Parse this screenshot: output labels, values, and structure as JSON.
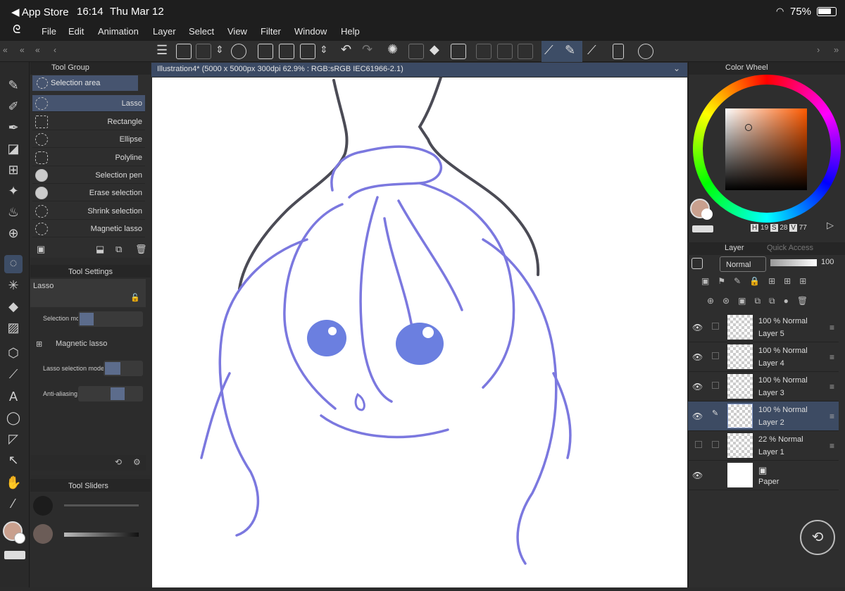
{
  "status": {
    "back": "◀ App Store",
    "time": "16:14",
    "date": "Thu Mar 12",
    "battery": "75%"
  },
  "menu": [
    "File",
    "Edit",
    "Animation",
    "Layer",
    "Select",
    "View",
    "Filter",
    "Window",
    "Help"
  ],
  "tool_group": {
    "title": "Tool Group",
    "active": "Selection area",
    "items": [
      "Lasso",
      "Rectangle",
      "Ellipse",
      "Polyline",
      "Selection pen",
      "Erase selection",
      "Shrink selection",
      "Magnetic lasso"
    ]
  },
  "tool_settings": {
    "title": "Tool Settings",
    "tool_name": "Lasso",
    "selection_mode_label": "Selection mo",
    "magnetic_label": "Magnetic lasso",
    "lasso_mode_label": "Lasso selection mode",
    "antialias_label": "Anti-aliasing"
  },
  "tool_sliders": {
    "title": "Tool Sliders"
  },
  "document": {
    "tab": "Illustration4* (5000 x 5000px 300dpi 62.9% : RGB:sRGB IEC61966-2.1)"
  },
  "color": {
    "tab": "Color Wheel",
    "h_label": "H",
    "h_value": "19",
    "s_label": "S",
    "s_value": "28",
    "v_label": "V",
    "v_value": "77",
    "main_color": "#c9a08e",
    "sub_color": "#6b5c57"
  },
  "layer_panel": {
    "tab": "Layer",
    "tab2": "Quick Access",
    "blend_mode": "Normal",
    "opacity": "100",
    "layers": [
      {
        "opacity": "100 %",
        "mode": "Normal",
        "name": "Layer 5",
        "visible": true
      },
      {
        "opacity": "100 %",
        "mode": "Normal",
        "name": "Layer 4",
        "visible": true
      },
      {
        "opacity": "100 %",
        "mode": "Normal",
        "name": "Layer 3",
        "visible": true
      },
      {
        "opacity": "100 %",
        "mode": "Normal",
        "name": "Layer 2",
        "visible": true
      },
      {
        "opacity": "22 %",
        "mode": "Normal",
        "name": "Layer 1",
        "visible": false
      }
    ],
    "paper": "Paper"
  }
}
